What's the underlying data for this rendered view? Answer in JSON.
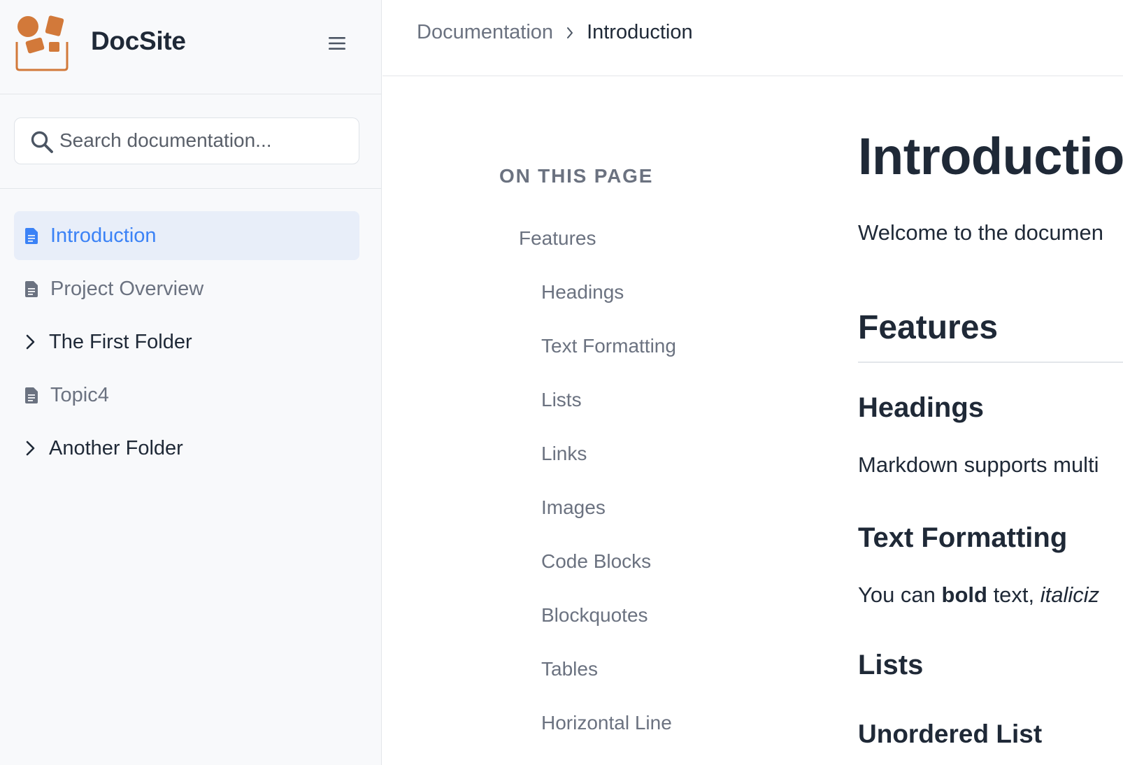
{
  "app": {
    "brand": "DocSite",
    "accent_color": "#3b82f6",
    "logo_color": "#d2793a"
  },
  "sidebar": {
    "search": {
      "placeholder": "Search documentation..."
    },
    "items": [
      {
        "label": "Introduction",
        "type": "page",
        "icon": "document-icon",
        "active": true
      },
      {
        "label": "Project Overview",
        "type": "page",
        "icon": "document-icon",
        "active": false
      },
      {
        "label": "The First Folder",
        "type": "folder",
        "icon": "chevron-right-icon",
        "active": false
      },
      {
        "label": "Topic4",
        "type": "page",
        "icon": "document-icon",
        "active": false
      },
      {
        "label": "Another Folder",
        "type": "folder",
        "icon": "chevron-right-icon",
        "active": false
      }
    ]
  },
  "breadcrumb": {
    "parent": "Documentation",
    "current": "Introduction"
  },
  "toc": {
    "title": "ON THIS PAGE",
    "items": [
      {
        "label": "Features",
        "level": 1
      },
      {
        "label": "Headings",
        "level": 2
      },
      {
        "label": "Text Formatting",
        "level": 2
      },
      {
        "label": "Lists",
        "level": 2
      },
      {
        "label": "Links",
        "level": 2
      },
      {
        "label": "Images",
        "level": 2
      },
      {
        "label": "Code Blocks",
        "level": 2
      },
      {
        "label": "Blockquotes",
        "level": 2
      },
      {
        "label": "Tables",
        "level": 2
      },
      {
        "label": "Horizontal Line",
        "level": 2
      }
    ]
  },
  "article": {
    "title": "Introductio",
    "intro": "Welcome to the documen",
    "features_heading": "Features",
    "headings_heading": "Headings",
    "headings_text": "Markdown supports multi",
    "text_formatting_heading": "Text Formatting",
    "tf_prefix": "You can ",
    "tf_bold": "bold",
    "tf_middle": " text, ",
    "tf_italic": "italiciz",
    "lists_heading": "Lists",
    "unordered_heading": "Unordered List"
  }
}
